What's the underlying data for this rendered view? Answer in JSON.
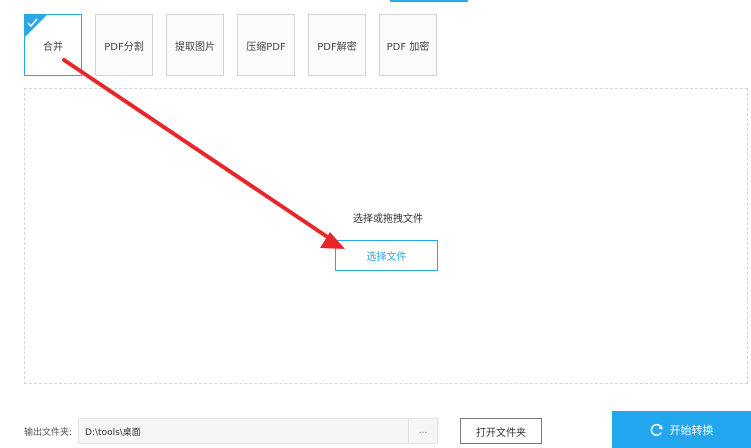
{
  "tabs": [
    {
      "label": "合并",
      "active": true
    },
    {
      "label": "PDF分割",
      "active": false
    },
    {
      "label": "提取图片",
      "active": false
    },
    {
      "label": "压缩PDF",
      "active": false
    },
    {
      "label": "PDF解密",
      "active": false
    },
    {
      "label": "PDF 加密",
      "active": false
    }
  ],
  "dropzone": {
    "hint": "选择或拖拽文件",
    "select_button": "选择文件"
  },
  "output": {
    "label": "输出文件夹:",
    "path": "D:\\tools\\桌面",
    "browse_label": "...",
    "open_folder_button": "打开文件夹"
  },
  "start_button": "开始转换",
  "colors": {
    "accent": "#29a8e6",
    "start_button_bg": "#22a6ee",
    "annotation_arrow": "#e8262a"
  },
  "icons": {
    "active_tab_check": "check-icon",
    "start_button": "refresh-icon",
    "annotation": "arrow-annotation"
  }
}
